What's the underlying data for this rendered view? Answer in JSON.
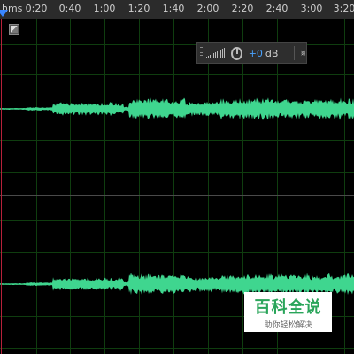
{
  "timeline": {
    "unit": "hms",
    "ticks": [
      "0:20",
      "0:40",
      "1:00",
      "1:20",
      "1:40",
      "2:00",
      "2:20",
      "2:40",
      "3:00",
      "3:20"
    ]
  },
  "hud": {
    "volume_value": "+0",
    "volume_unit": "dB"
  },
  "watermark": {
    "title": "百科全说",
    "subtitle": "助你轻松解决"
  },
  "colors": {
    "waveform": "#3fd68f",
    "grid": "#0f3d0f",
    "playhead": "#3a86ff",
    "volume_value": "#4aa3ff"
  }
}
